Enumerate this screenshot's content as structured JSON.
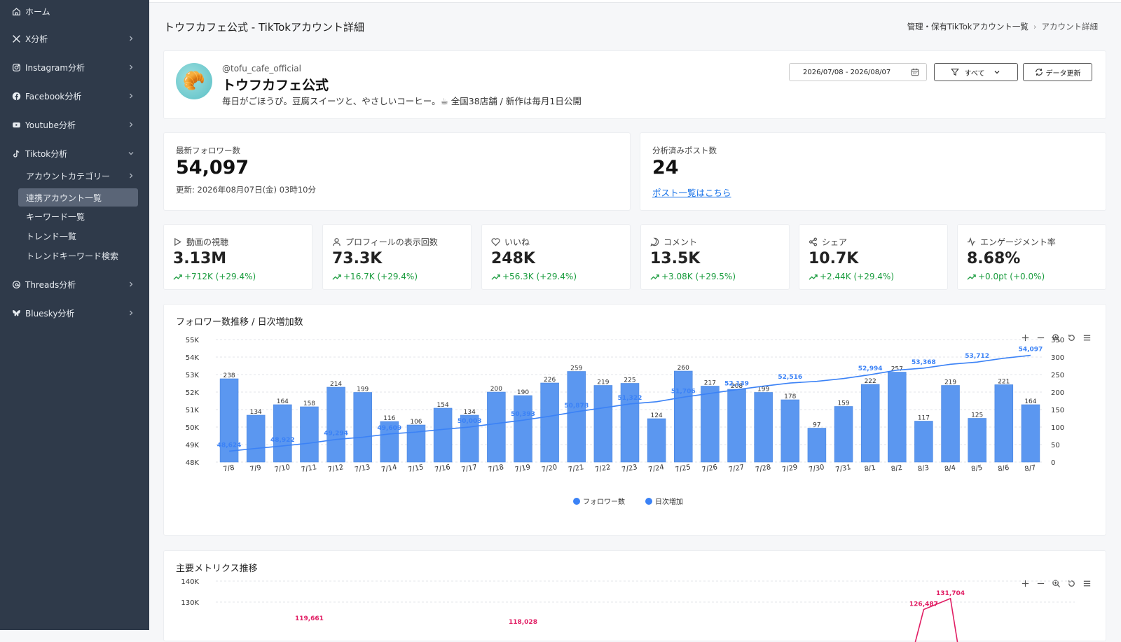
{
  "sidebar": {
    "items": [
      {
        "label": "ホーム",
        "icon": "home-icon"
      },
      {
        "label": "X分析",
        "icon": "x-logo-icon"
      },
      {
        "label": "Instagram分析",
        "icon": "instagram-icon"
      },
      {
        "label": "Facebook分析",
        "icon": "facebook-icon"
      },
      {
        "label": "Youtube分析",
        "icon": "youtube-icon"
      },
      {
        "label": "Tiktok分析",
        "icon": "tiktok-icon"
      },
      {
        "label": "Threads分析",
        "icon": "threads-icon"
      },
      {
        "label": "Bluesky分析",
        "icon": "bluesky-icon"
      }
    ],
    "tiktok_sub": [
      {
        "label": "アカウントカテゴリー"
      },
      {
        "label": "連携アカウント一覧"
      },
      {
        "label": "キーワード一覧"
      },
      {
        "label": "トレンド一覧"
      },
      {
        "label": "トレンドキーワード検索"
      }
    ]
  },
  "header": {
    "title": "トウフカフェ公式 - TikTokアカウント詳細",
    "breadcrumb": [
      "管理・保有TikTokアカウント一覧",
      "アカウント詳細"
    ]
  },
  "profile": {
    "handle": "@tofu_cafe_official",
    "name": "トウフカフェ公式",
    "bio": "毎日がごほうび。豆腐スイーツと、やさしいコーヒー。☕ 全国38店舗 / 新作は毎月1日公開",
    "avatar_emoji": "🥐",
    "date_range": "2026/07/08 - 2026/08/07",
    "filter_label": "すべて",
    "refresh_label": "データ更新"
  },
  "summary": {
    "followers_label": "最新フォロワー数",
    "followers_value": "54,097",
    "updated": "更新: 2026年08月07日(金) 03時10分",
    "posts_label": "分析済みポスト数",
    "posts_value": "24",
    "posts_link": "ポスト一覧はこちら"
  },
  "kpis": [
    {
      "label": "動画の視聴",
      "value": "3.13M",
      "change": "+712K (+29.4%)",
      "icon": "play-icon"
    },
    {
      "label": "プロフィールの表示回数",
      "value": "73.3K",
      "change": "+16.7K (+29.4%)",
      "icon": "user-icon"
    },
    {
      "label": "いいね",
      "value": "248K",
      "change": "+56.3K (+29.4%)",
      "icon": "heart-icon"
    },
    {
      "label": "コメント",
      "value": "13.5K",
      "change": "+3.08K (+29.5%)",
      "icon": "comment-icon"
    },
    {
      "label": "シェア",
      "value": "10.7K",
      "change": "+2.44K (+29.4%)",
      "icon": "share-icon"
    },
    {
      "label": "エンゲージメント率",
      "value": "8.68%",
      "change": "+0.0pt (+0.0%)",
      "icon": "activity-icon"
    }
  ],
  "colors": {
    "bar": "#5b97f0",
    "line": "#3b82f6",
    "up": "#1a9c3e",
    "sidebar": "#2f3a4a",
    "pink": "#e11d63"
  },
  "chart_data": [
    {
      "type": "bar",
      "title": "フォロワー数推移 / 日次増加数",
      "categories": [
        "7/8",
        "7/9",
        "7/10",
        "7/11",
        "7/12",
        "7/13",
        "7/14",
        "7/15",
        "7/16",
        "7/17",
        "7/18",
        "7/19",
        "7/20",
        "7/21",
        "7/22",
        "7/23",
        "7/24",
        "7/25",
        "7/26",
        "7/27",
        "7/28",
        "7/29",
        "7/30",
        "7/31",
        "8/1",
        "8/2",
        "8/3",
        "8/4",
        "8/5",
        "8/6",
        "8/7"
      ],
      "series": [
        {
          "name": "日次増加",
          "type": "bar",
          "axis": "right",
          "values": [
            238,
            134,
            164,
            158,
            214,
            199,
            116,
            106,
            154,
            134,
            200,
            190,
            226,
            259,
            219,
            225,
            124,
            260,
            217,
            208,
            199,
            178,
            97,
            159,
            222,
            257,
            117,
            219,
            125,
            221,
            164
          ]
        },
        {
          "name": "フォロワー数",
          "type": "line",
          "axis": "left",
          "values": [
            48624,
            48780,
            48922,
            49080,
            49294,
            49420,
            49609,
            49715,
            49869,
            50003,
            50203,
            50393,
            50619,
            50878,
            51097,
            51322,
            51446,
            51706,
            51923,
            52139,
            52338,
            52516,
            52613,
            52772,
            52994,
            53251,
            53368,
            53587,
            53712,
            53933,
            54097
          ],
          "labels": {
            "0": "48,624",
            "2": "48,922",
            "4": "49,294",
            "6": "49,609",
            "9": "50,003",
            "11": "50,393",
            "13": "50,878",
            "15": "51,322",
            "17": "51,706",
            "19": "52,139",
            "21": "52,516",
            "24": "52,994",
            "26": "53,368",
            "28": "53,712",
            "30": "54,097"
          }
        }
      ],
      "yleft": {
        "min": 48000,
        "max": 55000,
        "ticks": [
          "48K",
          "49K",
          "50K",
          "51K",
          "52K",
          "53K",
          "54K",
          "55K"
        ]
      },
      "yright": {
        "min": 0,
        "max": 350,
        "ticks": [
          "0",
          "50",
          "100",
          "150",
          "200",
          "250",
          "300",
          "350"
        ]
      },
      "legend": [
        "フォロワー数",
        "日次増加"
      ],
      "legend_position": "bottom",
      "grid": true
    },
    {
      "type": "line",
      "title": "主要メトリクス推移",
      "yticks": [
        "130K",
        "140K"
      ],
      "visible_labels": [
        {
          "text": "119,661",
          "x_index": 3,
          "value": 119661
        },
        {
          "text": "118,028",
          "x_index": 11,
          "value": 118028
        },
        {
          "text": "126,487",
          "x_index": 26,
          "value": 126487
        },
        {
          "text": "131,704",
          "x_index": 27,
          "value": 131704
        }
      ]
    }
  ]
}
